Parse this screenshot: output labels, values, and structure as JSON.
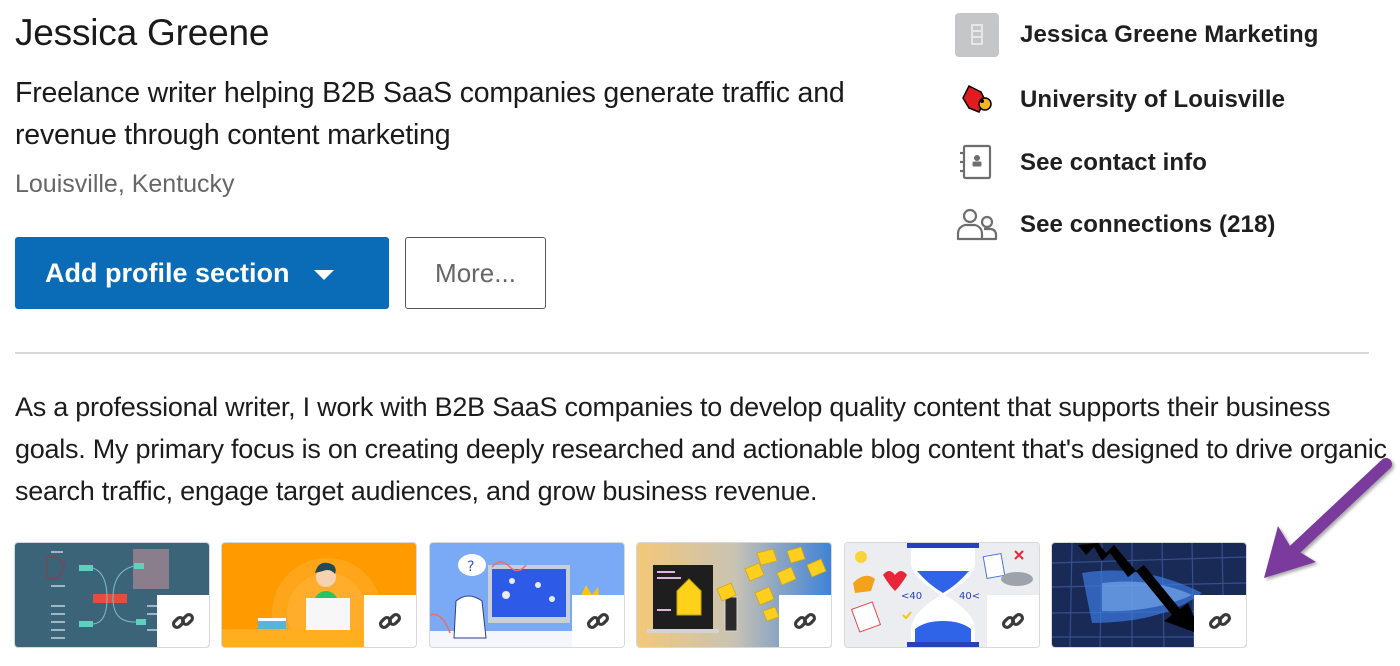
{
  "profile": {
    "name": "Jessica Greene",
    "headline": "Freelance writer helping B2B SaaS companies generate traffic and revenue through content marketing",
    "location": "Louisville, Kentucky"
  },
  "actions": {
    "add_section_label": "Add profile section",
    "more_label": "More..."
  },
  "sidebar": {
    "items": [
      {
        "label": "Jessica Greene Marketing",
        "icon": "company-building-icon"
      },
      {
        "label": "University of Louisville",
        "icon": "cardinal-logo-icon"
      },
      {
        "label": "See contact info",
        "icon": "contact-book-icon"
      },
      {
        "label": "See connections (218)",
        "icon": "people-icon"
      }
    ]
  },
  "summary": {
    "text": "As a professional writer, I work with B2B SaaS companies to develop quality content that supports their business goals. My primary focus is on creating deeply researched and actionable blog content that's designed to drive organic search traffic, engage target audiences, and grow business revenue."
  },
  "media": {
    "items": [
      {
        "type": "link",
        "theme": "mind-map"
      },
      {
        "type": "link",
        "theme": "person-with-laptop"
      },
      {
        "type": "link",
        "theme": "mouse-whiteboard"
      },
      {
        "type": "link",
        "theme": "laptop-emails"
      },
      {
        "type": "link",
        "theme": "hourglass-illustration"
      },
      {
        "type": "link",
        "theme": "falling-arrow-money"
      }
    ]
  },
  "colors": {
    "primary_button": "#0a6bb7",
    "annotation_arrow": "#7a3a9c",
    "divider": "#d6d6d8"
  }
}
